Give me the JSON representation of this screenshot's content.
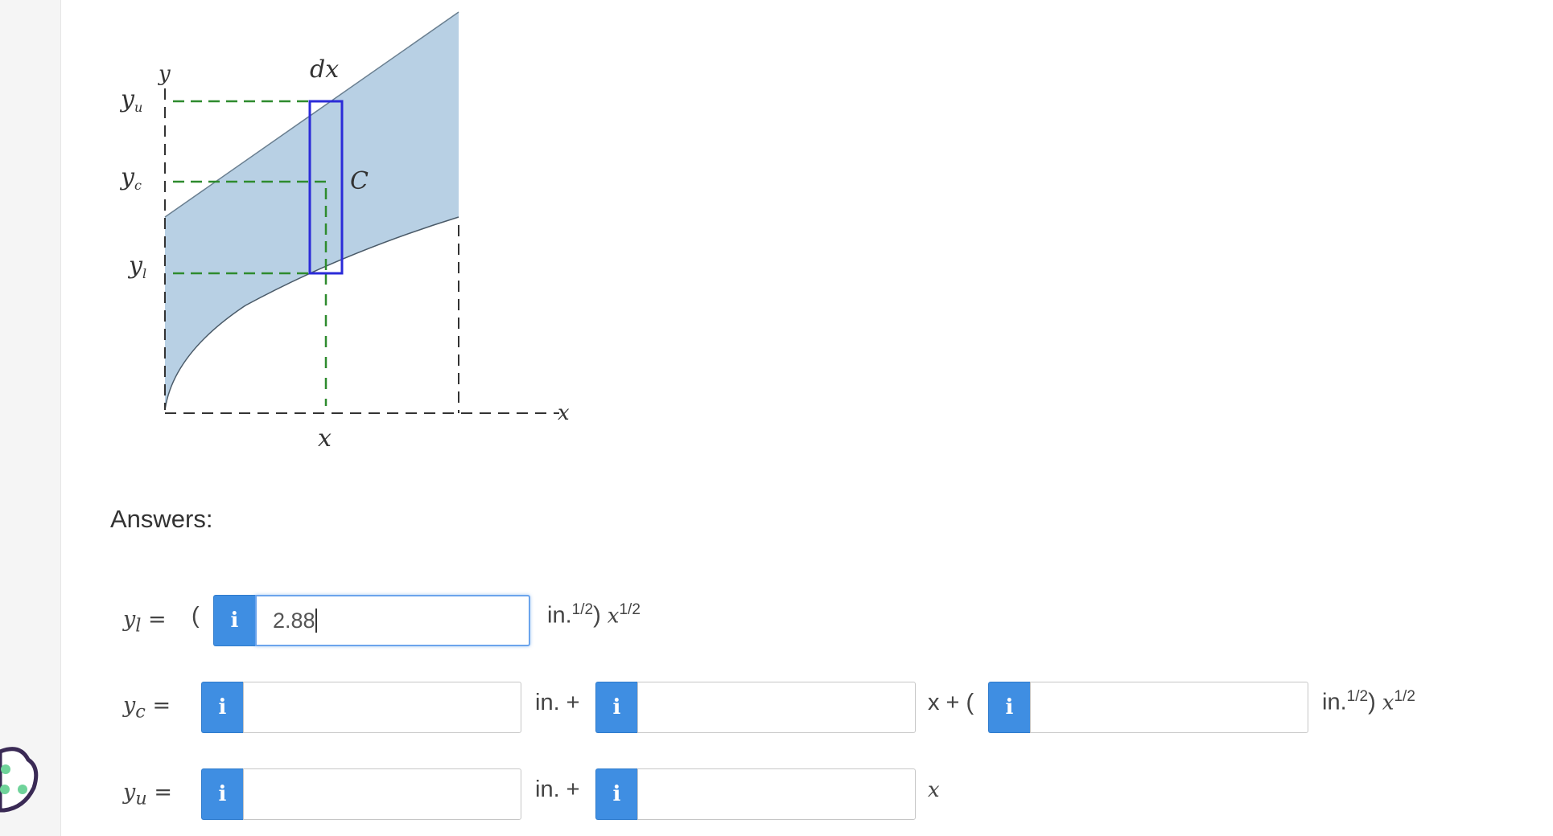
{
  "figure": {
    "labels": {
      "y_axis": "y",
      "x_axis": "x",
      "x_pos": "x",
      "dx": "dx",
      "C": "C",
      "yu": "y",
      "yu_sub": "u",
      "yc": "y",
      "yc_sub": "c",
      "yl": "y",
      "yl_sub": "l"
    },
    "colors": {
      "region_fill": "#b8d0e4",
      "element_stroke": "#2b2bd8",
      "centroid_dash": "#2e8b2e"
    }
  },
  "answers": {
    "heading": "Answers:",
    "yl": {
      "var": "y",
      "sub": "l",
      "eq": " =",
      "open_paren": "(",
      "value": "2.88",
      "unit": "in.",
      "unit_sup": "1/2",
      "close": ")",
      "x": "x",
      "x_sup": "1/2"
    },
    "yc": {
      "var": "y",
      "sub": "c",
      "eq": " =",
      "value1": "",
      "mid1": "in. +",
      "value2": "",
      "mid2": "x + (",
      "value3": "",
      "unit": "in.",
      "unit_sup": "1/2",
      "close": ")",
      "x": "x",
      "x_sup": "1/2"
    },
    "yu": {
      "var": "y",
      "sub": "u",
      "eq": " =",
      "value1": "",
      "mid1": "in. +",
      "value2": "",
      "end": "x"
    },
    "info_icon_glyph": "i"
  },
  "accent_color": "#3f8ee2"
}
